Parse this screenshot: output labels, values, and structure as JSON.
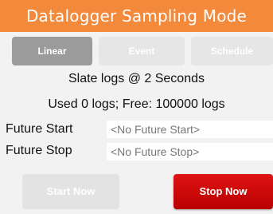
{
  "title": "Datalogger Sampling Mode",
  "tabs": [
    {
      "label": "Linear",
      "active": true
    },
    {
      "label": "Event",
      "active": false
    },
    {
      "label": "Schedule",
      "active": false
    }
  ],
  "status": {
    "sample_line": "Slate logs @  2 Seconds",
    "usage_line": "Used 0 logs; Free: 100000 logs"
  },
  "fields": {
    "future_start": {
      "label": "Future Start",
      "value": "<No Future Start>"
    },
    "future_stop": {
      "label": "Future Stop",
      "value": "<No Future Stop>"
    }
  },
  "buttons": {
    "start_now": "Start Now",
    "stop_now": "Stop Now"
  },
  "colors": {
    "title_bar": "#f2893b",
    "stop_button": "#d40b0b",
    "active_tab": "#9b9b9b"
  }
}
